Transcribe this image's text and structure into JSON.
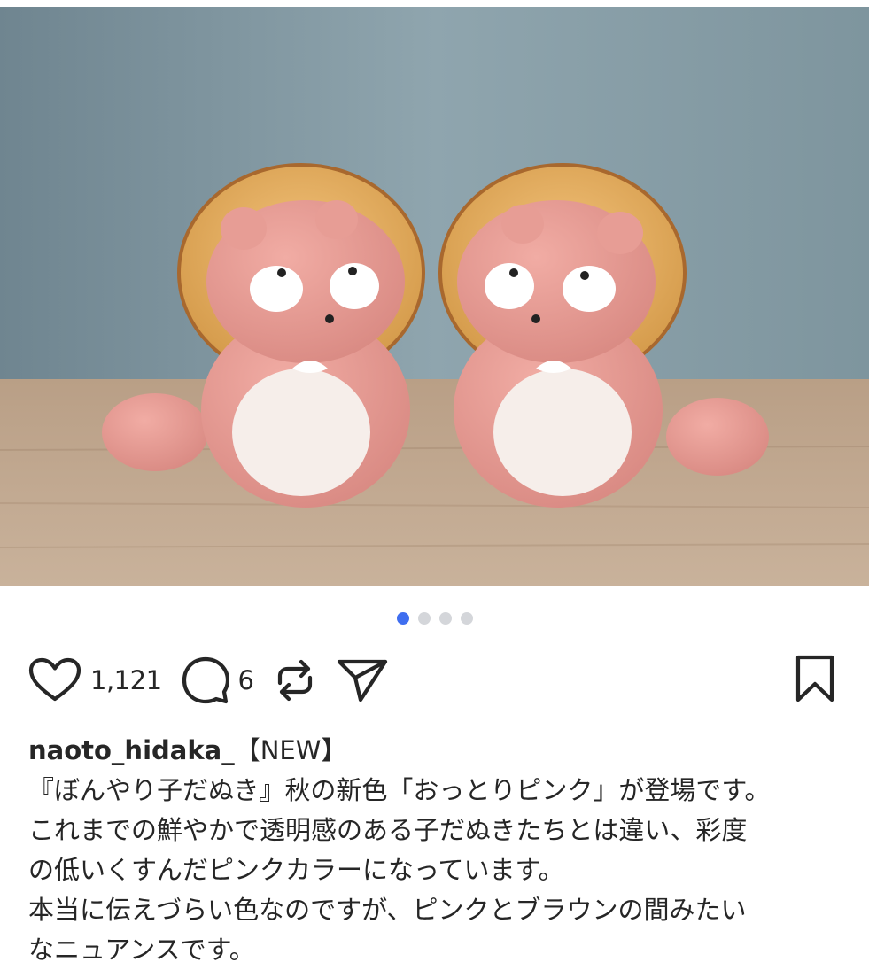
{
  "post": {
    "image_alt_icon": "photo-two-pink-tanuki-figurines",
    "carousel": {
      "count": 4,
      "active_index": 0,
      "active_color": "#3f6ef0",
      "inactive_color": "#d4d6da"
    },
    "likes": "1,121",
    "comments": "6",
    "username": "naoto_hidaka_",
    "tag": "【NEW】",
    "caption_lines": [
      "『ぼんやり子だぬき』秋の新色「おっとりピンク」が登場です。",
      "これまでの鮮やかで透明感のある子だぬきたちとは違い、彩度",
      "の低いくすんだピンクカラーになっています。",
      "本当に伝えづらい色なのですが、ピンクとブラウンの間みたい",
      "なニュアンスです。"
    ]
  }
}
